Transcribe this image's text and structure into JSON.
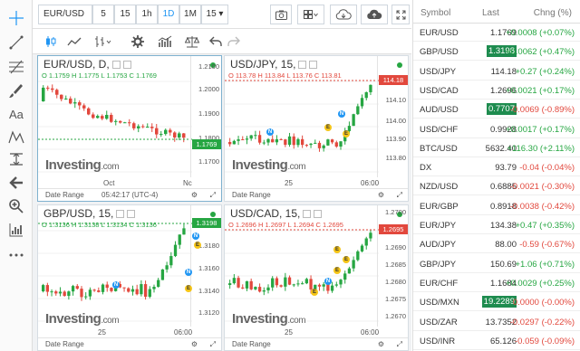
{
  "toolbar": {
    "symbol": "EUR/USD",
    "intervals": [
      "5",
      "15",
      "1h",
      "1D",
      "1M"
    ],
    "selected_interval": "1D",
    "interval_select": "15"
  },
  "left_tools": [
    "crosshair-icon",
    "trendline-icon",
    "fib-icon",
    "brush-icon",
    "text-icon",
    "pattern-icon",
    "measure-icon",
    "arrow-back-icon",
    "zoom-icon",
    "indicators-icon",
    "more-icon"
  ],
  "panels": [
    {
      "title": "EUR/USD, D,",
      "o": "1.1759",
      "h": "1.1775",
      "l": "1.1753",
      "c": "1.1769",
      "ticks": [
        "1.2100",
        "1.2000",
        "1.1900",
        "1.1800",
        "1.1700"
      ],
      "price": "1.1769",
      "xlabels": [
        "Oct",
        "Nc"
      ],
      "footer_left": "Date Range",
      "footer_time": "05:42:17 (UTC-4)",
      "color": "up"
    },
    {
      "title": "USD/JPY, 15,",
      "o": "113.78",
      "h": "113.84",
      "l": "113.76",
      "c": "113.81",
      "ticks": [
        "114.20",
        "114.10",
        "114.00",
        "113.90",
        "113.80"
      ],
      "price": "114.18",
      "xlabels": [
        "25",
        "06:00"
      ],
      "footer_left": "Date Range",
      "color": "dn"
    },
    {
      "title": "GBP/USD, 15,",
      "o": "1.3136",
      "h": "1.3138",
      "l": "1.3134",
      "c": "1.3136",
      "ticks": [
        "1.3180",
        "1.3160",
        "1.3140",
        "1.3120"
      ],
      "price": "1.3198",
      "xlabels": [
        "25",
        "06:00"
      ],
      "footer_left": "Date Range",
      "color": "up"
    },
    {
      "title": "USD/CAD, 15,",
      "o": "1.2696",
      "h": "1.2697",
      "l": "1.2694",
      "c": "1.2695",
      "ticks": [
        "1.2700",
        "1.2695",
        "1.2690",
        "1.2685",
        "1.2680",
        "1.2675",
        "1.2670"
      ],
      "price": "1.2695",
      "xlabels": [
        "25",
        "06:00"
      ],
      "footer_left": "Date Range",
      "color": "dn"
    }
  ],
  "watermark": {
    "brand": "Investing",
    "suffix": ".com"
  },
  "watchlist": {
    "headers": {
      "symbol": "Symbol",
      "last": "Last",
      "change": "Chng (%)"
    },
    "rows": [
      {
        "symbol": "EUR/USD",
        "last": "1.1769",
        "change": "+0.0008 (+0.07%)",
        "dir": "up",
        "hl": false
      },
      {
        "symbol": "GBP/USD",
        "last": "1.3198",
        "change": "+0.0062 (+0.47%)",
        "dir": "up",
        "hl": true
      },
      {
        "symbol": "USD/JPY",
        "last": "114.18",
        "change": "+0.27 (+0.24%)",
        "dir": "up",
        "hl": false
      },
      {
        "symbol": "USD/CAD",
        "last": "1.2696",
        "change": "+0.0021 (+0.17%)",
        "dir": "up",
        "hl": false
      },
      {
        "symbol": "AUD/USD",
        "last": "0.7707",
        "change": "-0.0069 (-0.89%)",
        "dir": "dn",
        "hl": true
      },
      {
        "symbol": "USD/CHF",
        "last": "0.9928",
        "change": "+0.0017 (+0.17%)",
        "dir": "up",
        "hl": false
      },
      {
        "symbol": "BTC/USD",
        "last": "5632.40",
        "change": "+116.30 (+2.11%)",
        "dir": "up",
        "hl": false
      },
      {
        "symbol": "DX",
        "last": "93.79",
        "change": "-0.04 (-0.04%)",
        "dir": "dn",
        "hl": false
      },
      {
        "symbol": "NZD/USD",
        "last": "0.6885",
        "change": "-0.0021 (-0.30%)",
        "dir": "dn",
        "hl": false
      },
      {
        "symbol": "EUR/GBP",
        "last": "0.8918",
        "change": "-0.0038 (-0.42%)",
        "dir": "dn",
        "hl": false
      },
      {
        "symbol": "EUR/JPY",
        "last": "134.38",
        "change": "+0.47 (+0.35%)",
        "dir": "up",
        "hl": false
      },
      {
        "symbol": "AUD/JPY",
        "last": "88.00",
        "change": "-0.59 (-0.67%)",
        "dir": "dn",
        "hl": false
      },
      {
        "symbol": "GBP/JPY",
        "last": "150.69",
        "change": "+1.06 (+0.71%)",
        "dir": "up",
        "hl": false
      },
      {
        "symbol": "EUR/CHF",
        "last": "1.1684",
        "change": "+0.0029 (+0.25%)",
        "dir": "up",
        "hl": false
      },
      {
        "symbol": "USD/MXN",
        "last": "19.2289",
        "change": "0.0000 (-0.00%)",
        "dir": "dn",
        "hl": true
      },
      {
        "symbol": "USD/ZAR",
        "last": "13.7352",
        "change": "-0.0297 (-0.22%)",
        "dir": "dn",
        "hl": false
      },
      {
        "symbol": "USD/INR",
        "last": "65.126",
        "change": "-0.059 (-0.09%)",
        "dir": "dn",
        "hl": false
      }
    ]
  }
}
